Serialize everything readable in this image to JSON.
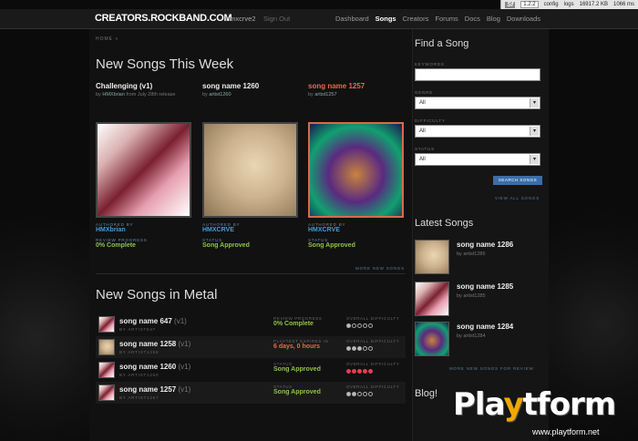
{
  "debug": {
    "sf": "Sf",
    "version": "1.2.2",
    "config": "config",
    "logs": "logs",
    "memory": "16917.2 KB",
    "time": "1066 ms"
  },
  "nav": {
    "logo": "CREATORS.ROCKBAND.COM",
    "user": "hmxcrve2",
    "signout": "Sign Out",
    "links": [
      "Dashboard",
      "Songs",
      "Creators",
      "Forums",
      "Docs",
      "Blog",
      "Downloads"
    ],
    "active": "Songs"
  },
  "breadcrumb": "HOME »",
  "new_songs": {
    "heading": "New Songs This Week",
    "items": [
      {
        "title": "Challenging (v1)",
        "by_prefix": "by",
        "by": "HMXbrian",
        "extra": "from July 28th release",
        "authored_label": "AUTHORED BY",
        "author": "HMXbrian",
        "status_label": "REVIEW PROGRESS",
        "status": "0% Complete"
      },
      {
        "title": "song name 1260",
        "by_prefix": "by",
        "by": "artist1260",
        "extra": "",
        "authored_label": "AUTHORED BY",
        "author": "HMXCRVE",
        "status_label": "STATUS",
        "status": "Song Approved"
      },
      {
        "title": "song name 1257",
        "by_prefix": "by",
        "by": "artist1257",
        "extra": "",
        "authored_label": "AUTHORED BY",
        "author": "HMXCRVE",
        "status_label": "STATUS",
        "status": "Song Approved"
      }
    ],
    "more": "MORE NEW SONGS"
  },
  "metal": {
    "heading": "New Songs in Metal",
    "rows": [
      {
        "name": "song name 647",
        "ver": "(v1)",
        "by": "BY ARTIST647",
        "stat_label": "REVIEW PROGRESS",
        "stat": "0% Complete",
        "stat_color": "#8fc24a",
        "diff_label": "OVERALL DIFFICULTY",
        "diff": 1
      },
      {
        "name": "song name 1258",
        "ver": "(v1)",
        "by": "BY ARTIST1258",
        "stat_label": "PLAYTEST EXPIRES IN",
        "stat": "6 days, 0 hours",
        "stat_color": "#e86a4a",
        "diff_label": "OVERALL DIFFICULTY",
        "diff": 3
      },
      {
        "name": "song name 1260",
        "ver": "(v1)",
        "by": "BY ARTIST1260",
        "stat_label": "STATUS",
        "stat": "Song Approved",
        "stat_color": "#8fc24a",
        "diff_label": "OVERALL DIFFICULTY",
        "diff": 5
      },
      {
        "name": "song name 1257",
        "ver": "(v1)",
        "by": "BY ARTIST1257",
        "stat_label": "STATUS",
        "stat": "Song Approved",
        "stat_color": "#8fc24a",
        "diff_label": "OVERALL DIFFICULTY",
        "diff": 2
      }
    ]
  },
  "find": {
    "heading": "Find a Song",
    "keywords_label": "KEYWORDS",
    "genre_label": "GENRE",
    "genre": "All",
    "difficulty_label": "DIFFICULTY",
    "difficulty": "All",
    "status_label": "STATUS",
    "status": "All",
    "search_button": "SEARCH SONGS",
    "view_all": "VIEW ALL SONGS"
  },
  "latest": {
    "heading": "Latest Songs",
    "items": [
      {
        "name": "song name 1286",
        "by_prefix": "by",
        "by": "artist1286"
      },
      {
        "name": "song name 1285",
        "by_prefix": "by",
        "by": "artist1285"
      },
      {
        "name": "song name 1284",
        "by_prefix": "by",
        "by": "artist1284"
      }
    ],
    "more": "MORE NEW SONGS FOR REVIEW"
  },
  "blog": {
    "heading": "Blog!"
  },
  "watermark": {
    "pre": "Pla",
    "y": "y",
    "post": "tform",
    "url": "www.playtform.net"
  }
}
